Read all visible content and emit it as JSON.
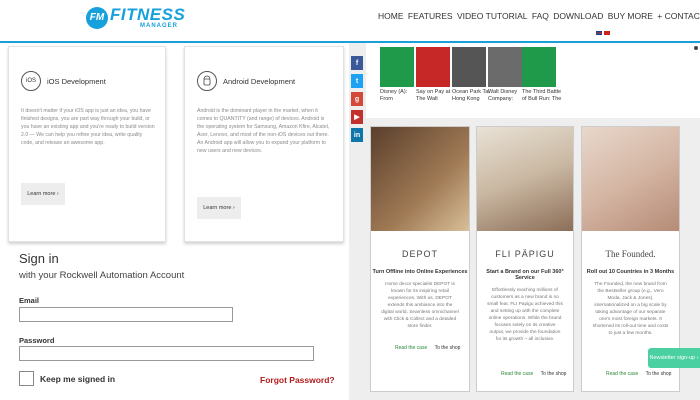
{
  "header": {
    "logo_badge": "FM",
    "logo_main": "FITNESS",
    "logo_sub": "MANAGER",
    "nav": [
      "HOME",
      "FEATURES",
      "VIDEO TUTORIAL",
      "FAQ",
      "DOWNLOAD",
      "BUY MORE",
      "+ CONTACT"
    ],
    "accent": "#1a9fd8"
  },
  "dev_cards": [
    {
      "icon": "iOS",
      "title": "iOS Development",
      "desc": "It doesn't matter if your iOS app is just an idea, you have finished designs, you are part way through your build, or you have an existing app and you're ready to build version 2.0 — We can help you refine your idea, write quality code, and release an awesome app.",
      "button": "Learn more ›"
    },
    {
      "icon": "android-icon",
      "title": "Android Development",
      "desc": "Android is the dominant player in the market, when it comes to QUANTITY (and range) of devices. Android is the operating system for Samsung, Amazon Kfire, Alcatel, Acer, Lenovo, and most of the non-iOS devices out there. An Android app will allow you to expand your platform to new users and new devices.",
      "button": "Learn more ›"
    }
  ],
  "signin": {
    "title": "Sign in",
    "subtitle": "with your Rockwell Automation Account",
    "email_label": "Email",
    "email_value": "",
    "password_label": "Password",
    "password_value": "",
    "keep_signed_in": "Keep me signed in",
    "forgot": "Forgot Password?"
  },
  "social_icons": [
    "facebook-icon",
    "twitter-icon",
    "google-plus-icon",
    "youtube-icon",
    "linkedin-icon"
  ],
  "books": [
    {
      "title": "Disney (A): From",
      "color": "#1f9a4a"
    },
    {
      "title": "Say on Pay at The Walt",
      "color": "#c62828"
    },
    {
      "title": "Ocean Park Tai Hong Kong",
      "color": "#555555"
    },
    {
      "title": "Walt Disney Company:",
      "color": "#6b6b6b"
    },
    {
      "title": "The Third Battle of Bull Run: The",
      "color": "#1f9a4a"
    }
  ],
  "ads": [
    {
      "brand": "DEPOT",
      "headline": "Turn Offline into Online Experiences",
      "body": "Home decor specialist DEPOT is known for its inspiring retail experiences. With us, DEPOT extends this ambiance into the digital world. Seamless omnichannel with Click & Collect and a detailed store finder.",
      "links": [
        "Read the case",
        "To the shop"
      ]
    },
    {
      "brand": "FLI PÄPIGU",
      "headline": "Start a Brand on our Full 360° Service",
      "body": "Effortlessly reaching millions of customers as a new brand is no small feat. FLI Papigu achieved this and setting up with the complete online operations. While the brand focuses solely on its creative output, we provide the foundation for its growth – all inclusive.",
      "links": [
        "Read the case",
        "To the shop"
      ]
    },
    {
      "brand": "The Founded.",
      "headline": "Roll out 10 Countries in 3 Months",
      "body": "The Founded, the new brand from the Bestseller group (e.g., Vero Moda, Jack & Jones), internationalized on a big scale by taking advantage of our separate one's most foreign markets. It shortened its roll-out time and costs to just a few months.",
      "links": [
        "Read the case",
        "To the shop"
      ]
    }
  ],
  "newsletter": "Newsletter sign-up ›"
}
